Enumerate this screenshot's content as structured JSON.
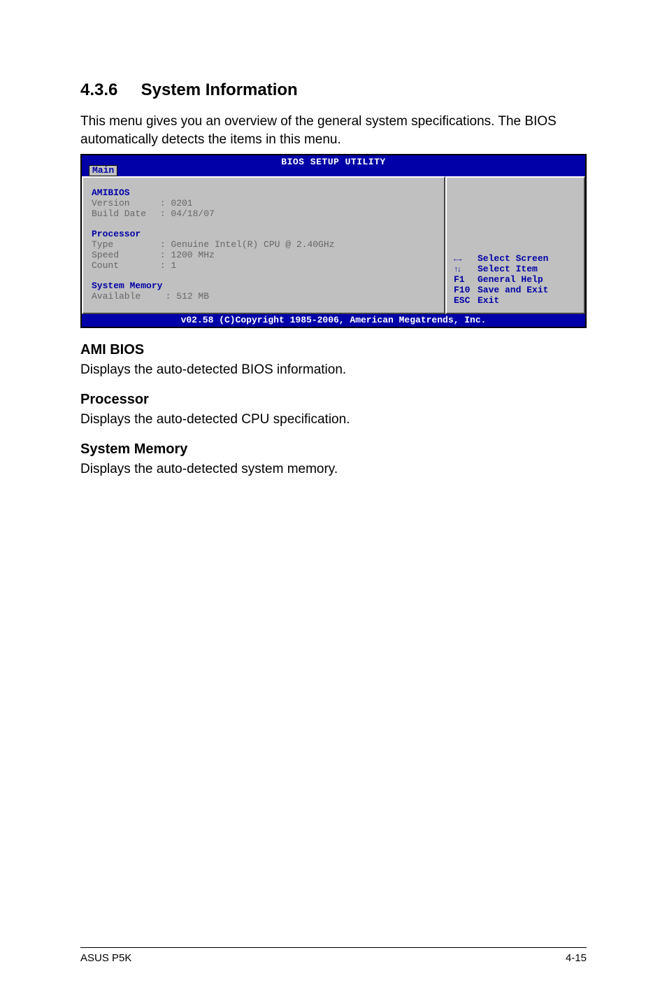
{
  "heading": {
    "num": "4.3.6",
    "title": "System Information"
  },
  "intro": "This menu gives you an overview of the general system specifications. The BIOS automatically detects the items in this menu.",
  "bios": {
    "title": "BIOS SETUP UTILITY",
    "tab": "Main",
    "sections": {
      "amibios": {
        "header": "AMIBIOS",
        "version_label": "Version",
        "version_value": "0201",
        "build_label": "Build Date",
        "build_value": "04/18/07"
      },
      "processor": {
        "header": "Processor",
        "type_label": "Type",
        "type_value": "Genuine Intel(R) CPU @ 2.40GHz",
        "speed_label": "Speed",
        "speed_value": "1200 MHz",
        "count_label": "Count",
        "count_value": "1"
      },
      "memory": {
        "header": "System Memory",
        "avail_label": "Available",
        "avail_value": "512 MB"
      }
    },
    "legend": {
      "select_screen": "Select Screen",
      "select_item": "Select Item",
      "f1_key": "F1",
      "f1_text": "General Help",
      "f10_key": "F10",
      "f10_text": "Save and Exit",
      "esc_key": "ESC",
      "esc_text": "Exit"
    },
    "footer": "v02.58 (C)Copyright 1985-2006, American Megatrends, Inc."
  },
  "subs": {
    "amibios": {
      "title": "AMI BIOS",
      "text": "Displays the auto-detected BIOS information."
    },
    "processor": {
      "title": "Processor",
      "text": "Displays the auto-detected CPU specification."
    },
    "memory": {
      "title": "System Memory",
      "text": "Displays the auto-detected system memory."
    }
  },
  "footer": {
    "left": "ASUS P5K",
    "right": "4-15"
  }
}
